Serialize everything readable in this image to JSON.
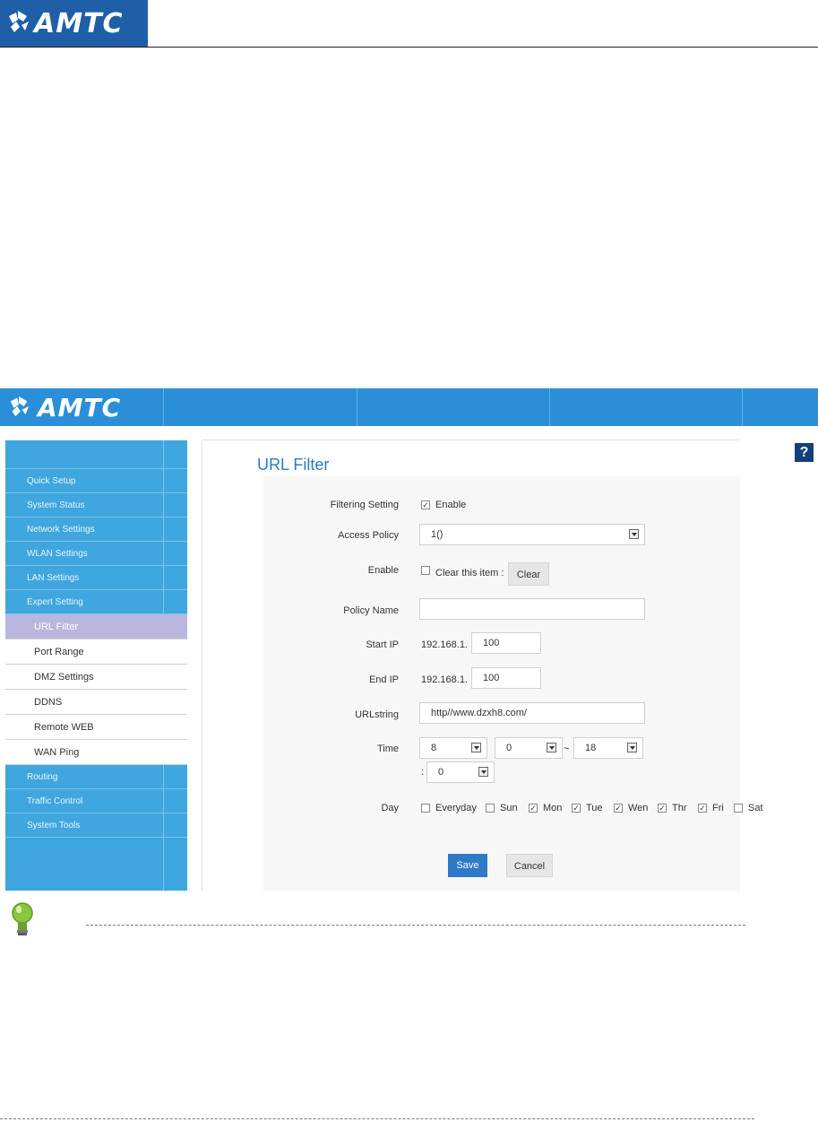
{
  "brand": {
    "logo_text": "AMTC"
  },
  "screen": {
    "title": "URL Filter",
    "help_label": "?",
    "sidebar": {
      "items": [
        {
          "label": "Quick Setup"
        },
        {
          "label": "System Status"
        },
        {
          "label": "Network Settings"
        },
        {
          "label": "WLAN Settings"
        },
        {
          "label": "LAN Settings"
        },
        {
          "label": "Expert Setting"
        }
      ],
      "sub_items": [
        {
          "label": "URL Filter",
          "active": true
        },
        {
          "label": "Port Range"
        },
        {
          "label": "DMZ Settings"
        },
        {
          "label": "DDNS"
        },
        {
          "label": "Remote WEB"
        },
        {
          "label": "WAN Ping"
        }
      ],
      "items_after": [
        {
          "label": "Routing"
        },
        {
          "label": "Traffic Control"
        },
        {
          "label": "System Tools"
        }
      ]
    },
    "form": {
      "filtering_setting": {
        "label": "Filtering Setting",
        "checked": true,
        "option": "Enable"
      },
      "access_policy": {
        "label": "Access Policy",
        "value": "1()"
      },
      "enable": {
        "label": "Enable",
        "checked": false,
        "option": "Clear this item :",
        "button": "Clear"
      },
      "policy_name": {
        "label": "Policy Name",
        "value": ""
      },
      "start_ip": {
        "label": "Start IP",
        "prefix": "192.168.1.",
        "value": "100"
      },
      "end_ip": {
        "label": "End IP",
        "prefix": "192.168.1.",
        "value": "100"
      },
      "urlstring": {
        "label": "URLstring",
        "value": "http//www.dzxh8.com/"
      },
      "time": {
        "label": "Time",
        "start_hour": "8",
        "start_minute": "0",
        "separator": "~",
        "end_hour": "18",
        "end_minute": "0",
        "colon": ":"
      },
      "day": {
        "label": "Day",
        "options": [
          {
            "label": "Everyday",
            "checked": false
          },
          {
            "label": "Sun",
            "checked": false
          },
          {
            "label": "Mon",
            "checked": true
          },
          {
            "label": "Tue",
            "checked": true
          },
          {
            "label": "Wen",
            "checked": true
          },
          {
            "label": "Thr",
            "checked": true
          },
          {
            "label": "Fri",
            "checked": true
          },
          {
            "label": "Sat",
            "checked": false
          }
        ]
      },
      "save_label": "Save",
      "cancel_label": "Cancel"
    }
  }
}
